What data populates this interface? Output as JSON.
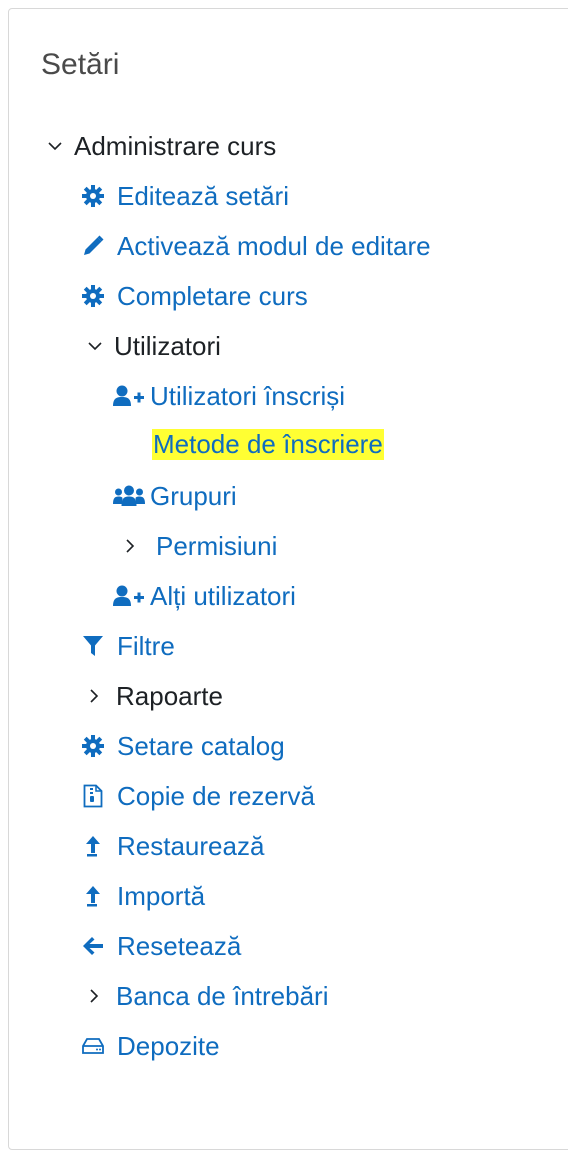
{
  "block": {
    "title": "Setări"
  },
  "nav": {
    "admin_label": "Administrare curs",
    "edit_settings": "Editează setări",
    "edit_mode": "Activează modul de editare",
    "course_completion": "Completare curs",
    "users": {
      "label": "Utilizatori",
      "enrolled": "Utilizatori înscriși",
      "enrol_methods": "Metode de înscriere",
      "groups": "Grupuri",
      "permissions": "Permisiuni",
      "other_users": "Alți utilizatori"
    },
    "filters": "Filtre",
    "reports": "Rapoarte",
    "gradebook_setup": "Setare catalog",
    "backup": "Copie de rezervă",
    "restore": "Restaurează",
    "import": "Importă",
    "reset": "Resetează",
    "question_bank": "Banca de întrebări",
    "repositories": "Depozite"
  },
  "colors": {
    "link": "#0f6cbf",
    "text": "#1d2125",
    "highlight": "#ffff33"
  }
}
